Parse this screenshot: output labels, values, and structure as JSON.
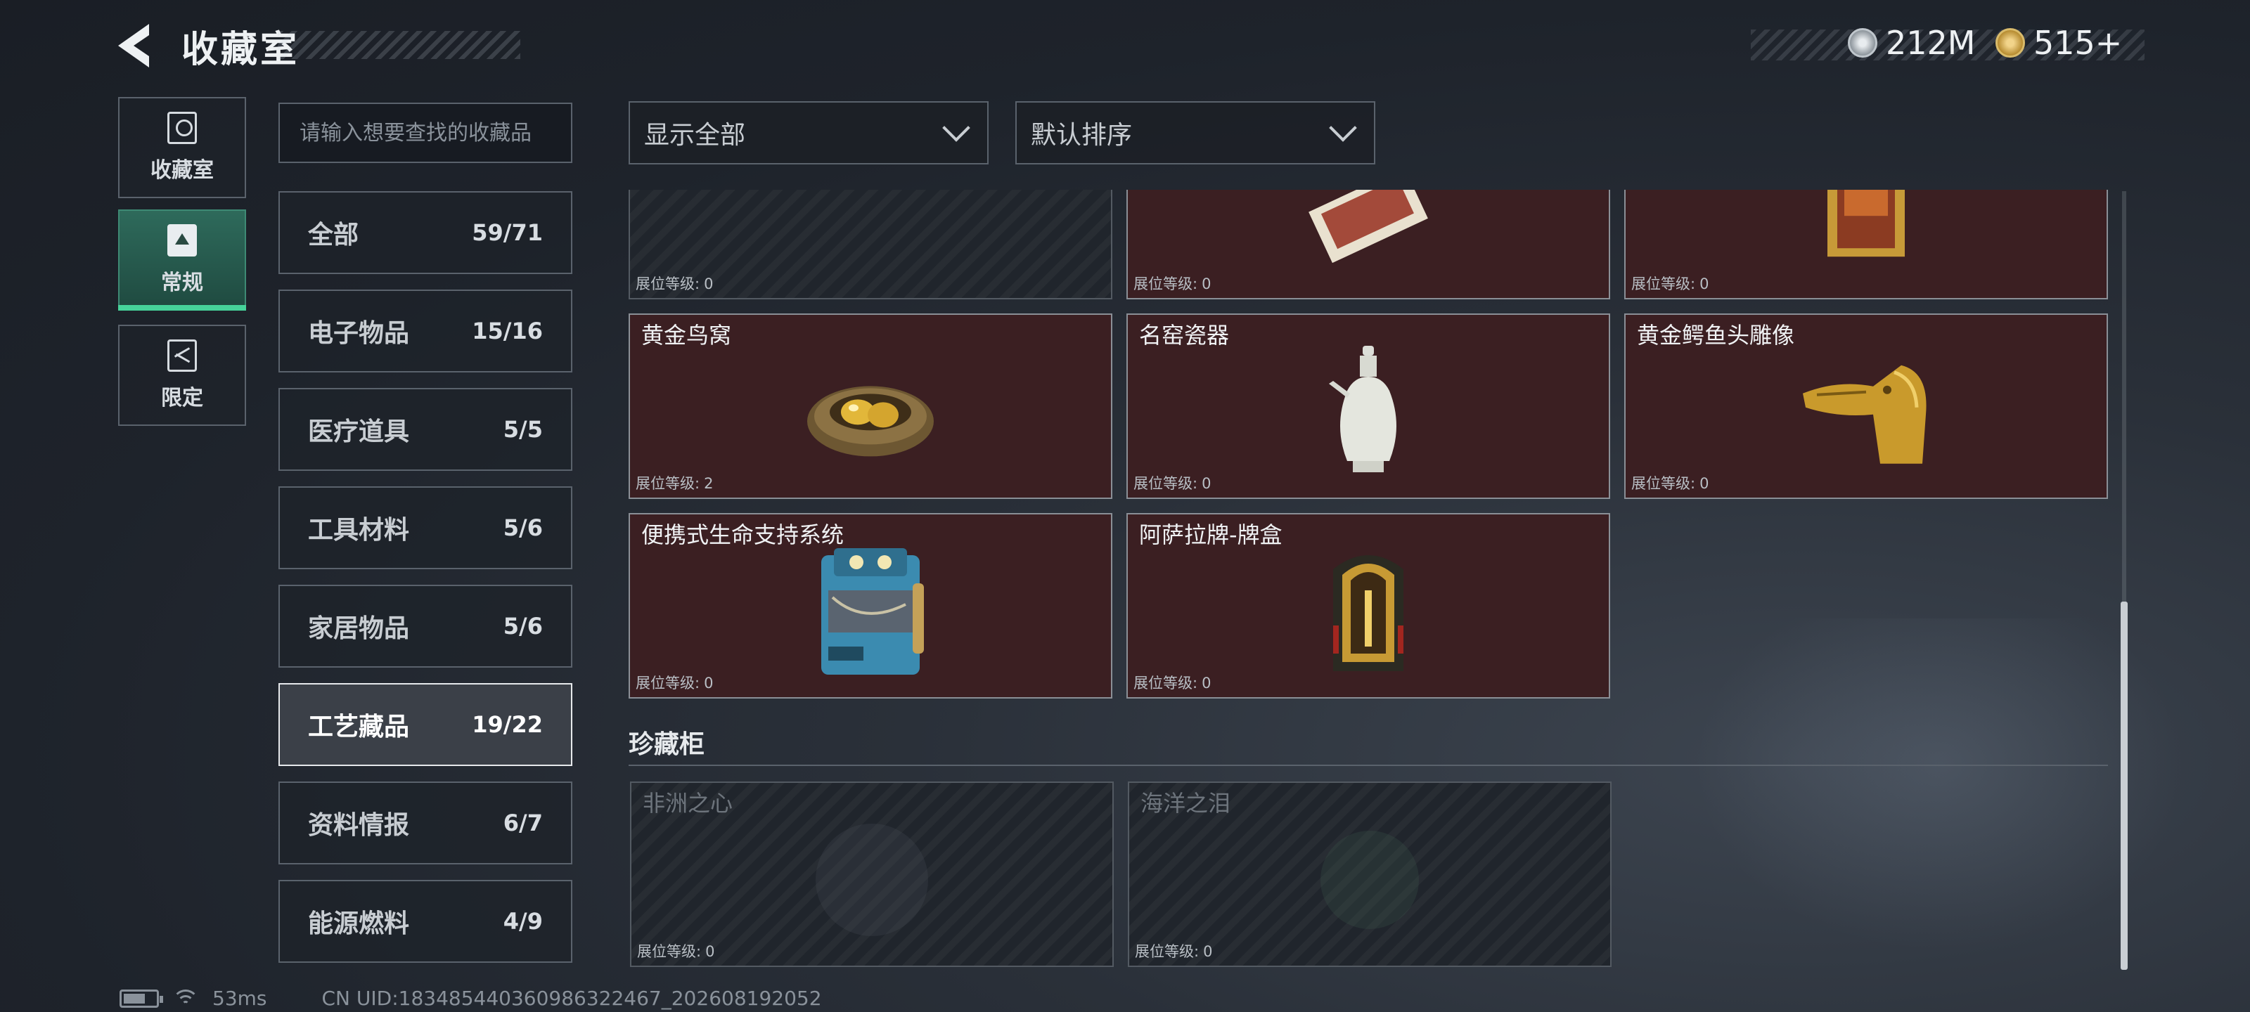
{
  "header": {
    "title": "收藏室",
    "currencies": [
      {
        "icon": "silver-coin-icon",
        "value": "212M"
      },
      {
        "icon": "gold-coin-icon",
        "value": "515+"
      }
    ]
  },
  "rail": {
    "tabs": [
      {
        "label": "收藏室",
        "icon": "trophy-icon",
        "active": false
      },
      {
        "label": "常规",
        "icon": "document-icon",
        "active": true
      },
      {
        "label": "限定",
        "icon": "limited-icon",
        "active": false
      }
    ]
  },
  "search": {
    "placeholder": "请输入想要查找的收藏品",
    "value": ""
  },
  "categories": [
    {
      "name": "全部",
      "count": "59/71"
    },
    {
      "name": "电子物品",
      "count": "15/16"
    },
    {
      "name": "医疗道具",
      "count": "5/5"
    },
    {
      "name": "工具材料",
      "count": "5/6"
    },
    {
      "name": "家居物品",
      "count": "5/6"
    },
    {
      "name": "工艺藏品",
      "count": "19/22",
      "active": true
    },
    {
      "name": "资料情报",
      "count": "6/7"
    },
    {
      "name": "能源燃料",
      "count": "4/9"
    }
  ],
  "filters": {
    "display": "显示全部",
    "sort": "默认排序"
  },
  "level_label": "展位等级:",
  "items": [
    {
      "title": "",
      "level": "0",
      "partial": true,
      "dim": true
    },
    {
      "title": "",
      "level": "0",
      "partial": true
    },
    {
      "title": "",
      "level": "0",
      "partial": true
    },
    {
      "title": "黄金鸟窝",
      "level": "2",
      "icon": "golden-nest-icon"
    },
    {
      "title": "名窑瓷器",
      "level": "0",
      "icon": "porcelain-vase-icon"
    },
    {
      "title": "黄金鳄鱼头雕像",
      "level": "0",
      "icon": "gold-crocodile-head-icon"
    },
    {
      "title": "便携式生命支持系统",
      "level": "0",
      "icon": "life-support-device-icon"
    },
    {
      "title": "阿萨拉牌-牌盒",
      "level": "0",
      "icon": "card-box-icon"
    }
  ],
  "section": {
    "title": "珍藏柜",
    "items": [
      {
        "title": "非洲之心",
        "level": "0",
        "icon": "heart-of-africa-icon"
      },
      {
        "title": "海洋之泪",
        "level": "0",
        "icon": "tear-of-ocean-icon"
      }
    ]
  },
  "footer": {
    "ping": "53ms",
    "uid": "CN UID:183485440360986322467_202608192052"
  },
  "colors": {
    "accent": "#46d39a",
    "card_bg": "#3b1f22",
    "card_dim_bg": "#20252c"
  }
}
